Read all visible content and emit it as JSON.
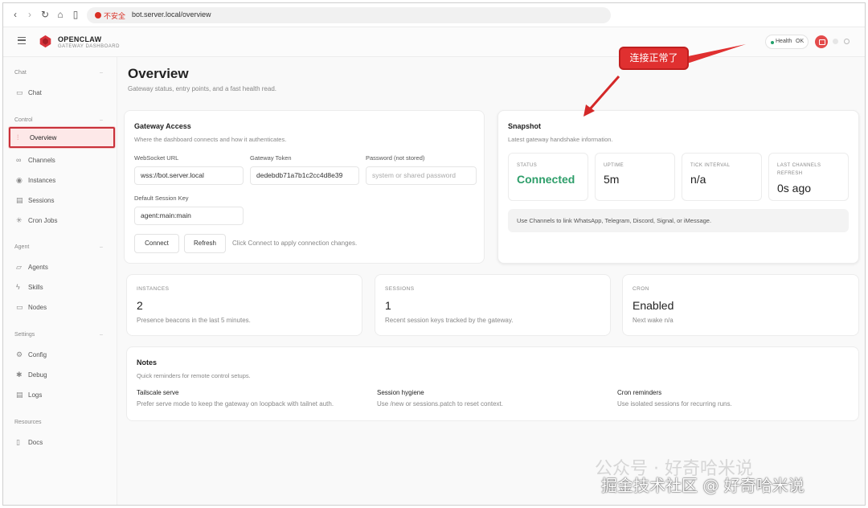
{
  "browser": {
    "insecure_label": "不安全",
    "url": "bot.server.local/overview"
  },
  "header": {
    "brand": "OPENCLAW",
    "brand_sub": "GATEWAY DASHBOARD",
    "health_label": "Health",
    "health_status": "OK"
  },
  "sidebar": {
    "groups": {
      "chat": "Chat",
      "control": "Control",
      "agent": "Agent",
      "settings": "Settings",
      "resources": "Resources"
    },
    "items": {
      "chat": "Chat",
      "overview": "Overview",
      "channels": "Channels",
      "instances": "Instances",
      "sessions": "Sessions",
      "cron_jobs": "Cron Jobs",
      "agents": "Agents",
      "skills": "Skills",
      "nodes": "Nodes",
      "config": "Config",
      "debug": "Debug",
      "logs": "Logs",
      "docs": "Docs"
    }
  },
  "main": {
    "title": "Overview",
    "subtitle": "Gateway status, entry points, and a fast health read."
  },
  "gateway_access": {
    "title": "Gateway Access",
    "subtitle": "Where the dashboard connects and how it authenticates.",
    "websocket_label": "WebSocket URL",
    "websocket_value": "wss://bot.server.local",
    "token_label": "Gateway Token",
    "token_value": "dedebdb71a7b1c2cc4d8e39",
    "password_label": "Password (not stored)",
    "password_placeholder": "system or shared password",
    "session_key_label": "Default Session Key",
    "session_key_value": "agent:main:main",
    "connect_label": "Connect",
    "refresh_label": "Refresh",
    "hint": "Click Connect to apply connection changes."
  },
  "snapshot": {
    "title": "Snapshot",
    "subtitle": "Latest gateway handshake information.",
    "status_label": "STATUS",
    "status_value": "Connected",
    "uptime_label": "UPTIME",
    "uptime_value": "5m",
    "tick_label": "TICK INTERVAL",
    "tick_value": "n/a",
    "refresh_label": "LAST CHANNELS REFRESH",
    "refresh_value": "0s ago",
    "note": "Use Channels to link WhatsApp, Telegram, Discord, Signal, or iMessage.",
    "status_color": "#2e9e6a"
  },
  "stats": {
    "instances_label": "INSTANCES",
    "instances_value": "2",
    "instances_sub": "Presence beacons in the last 5 minutes.",
    "sessions_label": "SESSIONS",
    "sessions_value": "1",
    "sessions_sub": "Recent session keys tracked by the gateway.",
    "cron_label": "CRON",
    "cron_value": "Enabled",
    "cron_sub": "Next wake n/a"
  },
  "notes": {
    "title": "Notes",
    "subtitle": "Quick reminders for remote control setups.",
    "items": [
      {
        "head": "Tailscale serve",
        "text": "Prefer serve mode to keep the gateway on loopback with tailnet auth."
      },
      {
        "head": "Session hygiene",
        "text": "Use /new or sessions.patch to reset context."
      },
      {
        "head": "Cron reminders",
        "text": "Use isolated sessions for recurring runs."
      }
    ]
  },
  "annotation": {
    "callout": "连接正常了",
    "accent": "#e03030"
  },
  "watermark": {
    "line1": "公众号 · 好奇哈米说",
    "line2": "掘金技术社区 @ 好奇哈米说"
  }
}
